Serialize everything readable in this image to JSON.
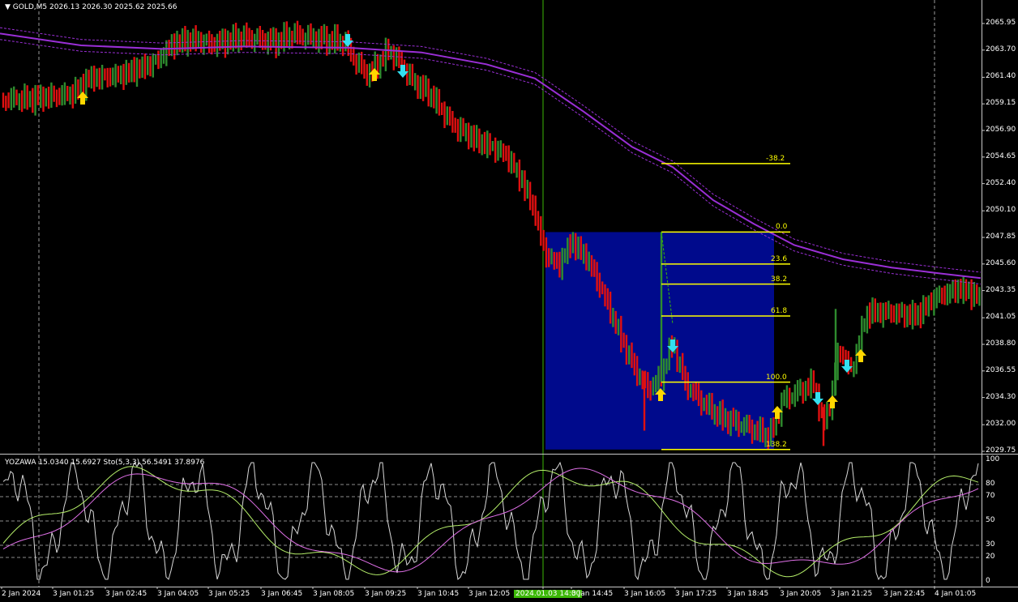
{
  "header": {
    "symbol": "GOLD,M5",
    "ohlc": "2026.13 2026.30 2025.62 2025.66",
    "dropdown_icon": "triangle-down-icon"
  },
  "sub_header": {
    "text": "YOZAWA 15.0340 15.6927  Sto(5,3,3) 56.5491 37.8976"
  },
  "price_axis": [
    "2065.95",
    "2063.70",
    "2061.40",
    "2059.15",
    "2056.90",
    "2054.65",
    "2052.40",
    "2050.10",
    "2047.85",
    "2045.60",
    "2043.35",
    "2041.05",
    "2038.80",
    "2036.55",
    "2034.30",
    "2032.00",
    "2029.75"
  ],
  "osc_axis": [
    "100",
    "80",
    "70",
    "50",
    "30",
    "20",
    "0"
  ],
  "time_axis": [
    "2 Jan 2024",
    "3 Jan 01:25",
    "3 Jan 02:45",
    "3 Jan 04:05",
    "3 Jan 05:25",
    "3 Jan 06:45",
    "3 Jan 08:05",
    "3 Jan 09:25",
    "3 Jan 10:45",
    "3 Jan 12:05",
    "2024.01.03 14:00",
    "3 Jan 14:45",
    "3 Jan 16:05",
    "3 Jan 17:25",
    "3 Jan 18:45",
    "3 Jan 20:05",
    "3 Jan 21:25",
    "3 Jan 22:45",
    "4 Jan 01:05"
  ],
  "highlighted_time": "2024.01.03 14:00",
  "fibonacci": {
    "levels": [
      "-38.2",
      "0.0",
      "23.6",
      "38.2",
      "61.8",
      "100.0",
      "138.2"
    ],
    "values": [
      2054.1,
      2048.3,
      2045.6,
      2043.9,
      2041.2,
      2035.6,
      2029.9
    ],
    "color": "#ffff00"
  },
  "colors": {
    "bull_bar": "#2e8b2e",
    "bear_bar": "#e01010",
    "moving_average": "#9a2fd6",
    "rectangle": "#000a8c",
    "buy_arrow": "#ffd700",
    "sell_arrow": "#33e0f0",
    "crosshair": "#3cb806"
  }
}
